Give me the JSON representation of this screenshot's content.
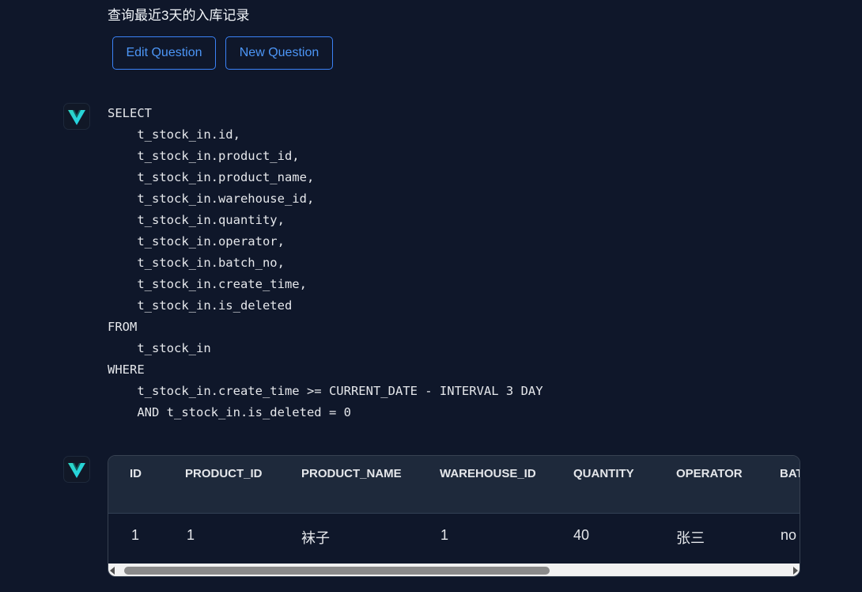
{
  "question": "查询最近3天的入库记录",
  "buttons": {
    "edit": "Edit Question",
    "new": "New Question"
  },
  "icons": {
    "assistant_logo": "vanna-chevron-logo-icon"
  },
  "colors": {
    "background": "#0f172a",
    "button_accent": "#3b82f6",
    "logo_teal": "#2dd4bf",
    "logo_cyan": "#22d3ee"
  },
  "sql": {
    "lines": [
      "SELECT",
      "    t_stock_in.id,",
      "    t_stock_in.product_id,",
      "    t_stock_in.product_name,",
      "    t_stock_in.warehouse_id,",
      "    t_stock_in.quantity,",
      "    t_stock_in.operator,",
      "    t_stock_in.batch_no,",
      "    t_stock_in.create_time,",
      "    t_stock_in.is_deleted",
      "FROM",
      "    t_stock_in",
      "WHERE",
      "    t_stock_in.create_time >= CURRENT_DATE - INTERVAL 3 DAY",
      "    AND t_stock_in.is_deleted = 0"
    ]
  },
  "result_table": {
    "columns": [
      "ID",
      "PRODUCT_ID",
      "PRODUCT_NAME",
      "WAREHOUSE_ID",
      "QUANTITY",
      "OPERATOR",
      "BAT"
    ],
    "rows": [
      [
        "1",
        "1",
        "袜子",
        "1",
        "40",
        "张三",
        "no"
      ]
    ]
  }
}
